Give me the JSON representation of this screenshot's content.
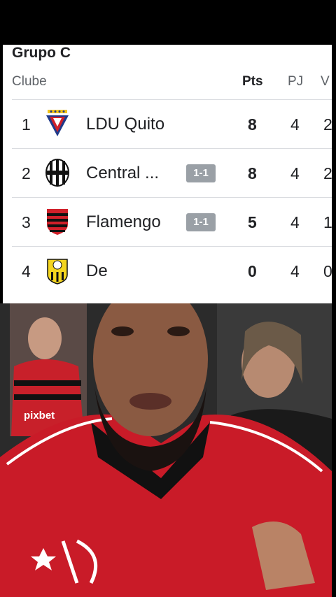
{
  "group": {
    "title": "Grupo C"
  },
  "headers": {
    "club": "Clube",
    "pts": "Pts",
    "pj": "PJ",
    "v": "V"
  },
  "rows": [
    {
      "pos": "1",
      "name": "LDU Quito",
      "badge": "",
      "pts": "8",
      "pj": "4",
      "v": "2"
    },
    {
      "pos": "2",
      "name": "Central ...",
      "badge": "1-1",
      "pts": "8",
      "pj": "4",
      "v": "2"
    },
    {
      "pos": "3",
      "name": "Flamengo",
      "badge": "1-1",
      "pts": "5",
      "pj": "4",
      "v": "1"
    },
    {
      "pos": "4",
      "name": "De",
      "badge": "",
      "pts": "0",
      "pj": "4",
      "v": "0"
    }
  ],
  "overlay": {
    "sponsor_text": "pixbet"
  },
  "colors": {
    "flamengo_red": "#d0202a",
    "flamengo_black": "#111111",
    "ldu_blue": "#1f3a8a"
  }
}
